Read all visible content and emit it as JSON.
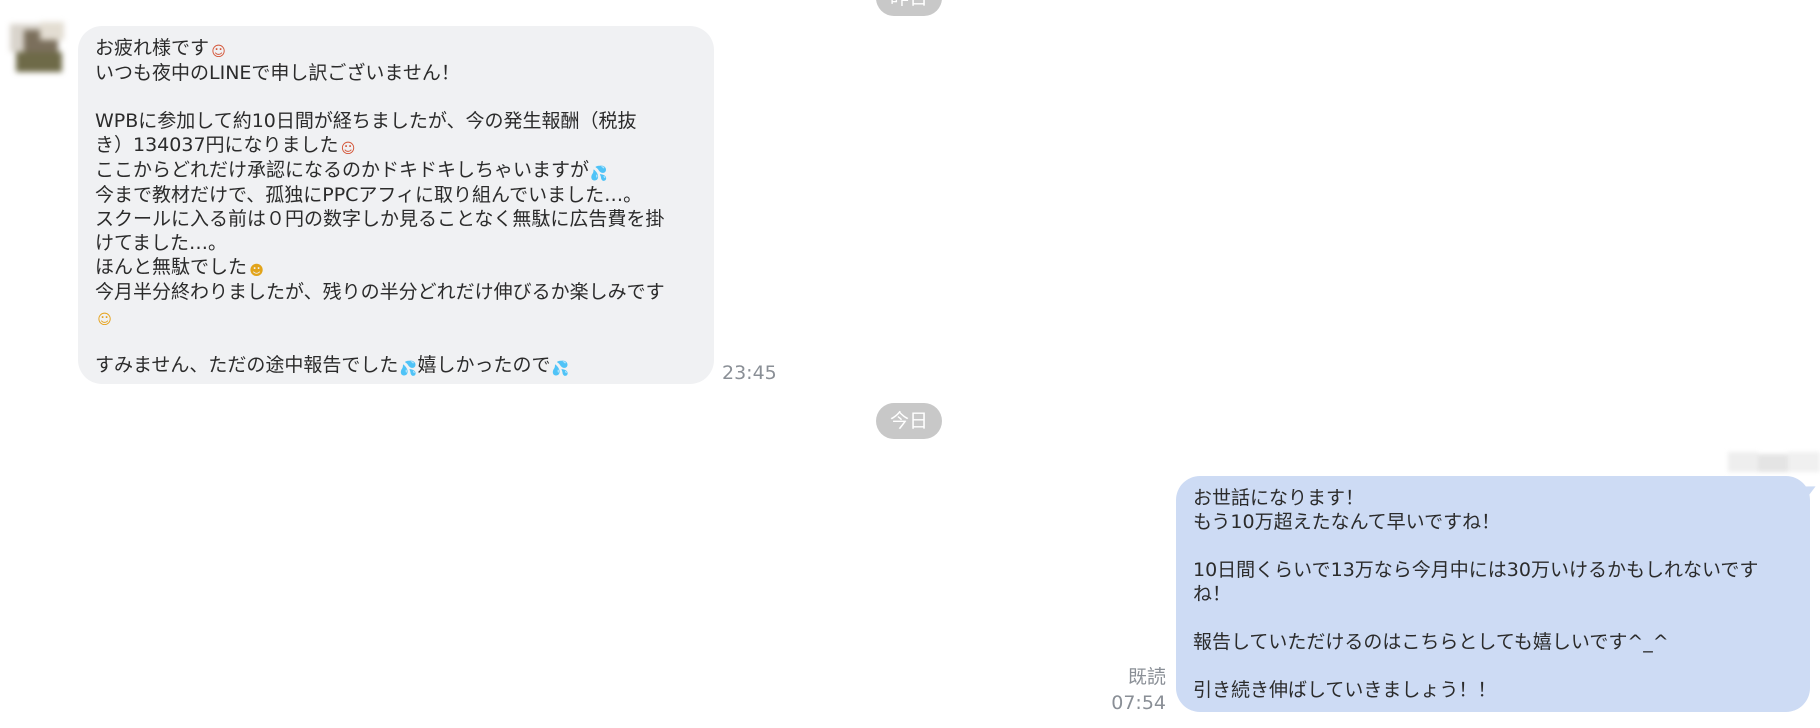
{
  "date_separators": {
    "top": "昨日",
    "mid": "今日"
  },
  "incoming": {
    "time": "23:45",
    "lines": [
      [
        {
          "t": "お疲れ様です"
        },
        {
          "e": "person"
        }
      ],
      [
        {
          "t": "いつも夜中のLINEで申し訳ございません！"
        }
      ],
      [],
      [
        {
          "t": "WPBに参加して約10日間が経ちましたが、今の発生報酬（税抜"
        }
      ],
      [
        {
          "t": "き）134037円になりました"
        },
        {
          "e": "person"
        }
      ],
      [
        {
          "t": "ここからどれだけ承認になるのかドキドキしちゃいますが"
        },
        {
          "e": "sweat"
        }
      ],
      [
        {
          "t": "今まで教材だけで、孤独にPPCアフィに取り組んでいました…。"
        }
      ],
      [
        {
          "t": "スクールに入る前は０円の数字しか見ることなく無駄に広告費を掛"
        }
      ],
      [
        {
          "t": "けてました…。"
        }
      ],
      [
        {
          "t": "ほんと無駄でした"
        },
        {
          "e": "laugh"
        }
      ],
      [
        {
          "t": "今月半分終わりましたが、残りの半分どれだけ伸びるか楽しみです"
        }
      ],
      [
        {
          "e": "smile"
        }
      ],
      [],
      [
        {
          "t": "すみません、ただの途中報告でした"
        },
        {
          "e": "sweat"
        },
        {
          "t": "嬉しかったので"
        },
        {
          "e": "sweat"
        }
      ]
    ]
  },
  "outgoing": {
    "read_label": "既読",
    "time": "07:54",
    "lines": [
      [
        {
          "t": "お世話になります！"
        }
      ],
      [
        {
          "t": "もう10万超えたなんて早いですね！"
        }
      ],
      [],
      [
        {
          "t": "10日間くらいで13万なら今月中には30万いけるかもしれないです"
        }
      ],
      [
        {
          "t": "ね！"
        }
      ],
      [],
      [
        {
          "t": "報告していただけるのはこちらとしても嬉しいです^_^"
        }
      ],
      [],
      [
        {
          "t": "引き続き伸ばしていきましょう！！"
        }
      ]
    ]
  },
  "emoji_icons": {
    "person": "person-gesturing-icon",
    "sweat": "sweat-droplets-icon",
    "laugh": "grinning-sweat-icon",
    "smile": "smiling-face-icon"
  },
  "colors": {
    "incoming_bubble": "#f0f1f3",
    "outgoing_bubble": "#cddbf4",
    "date_pill": "#c8c8c8",
    "timestamp": "#8a8f96"
  }
}
